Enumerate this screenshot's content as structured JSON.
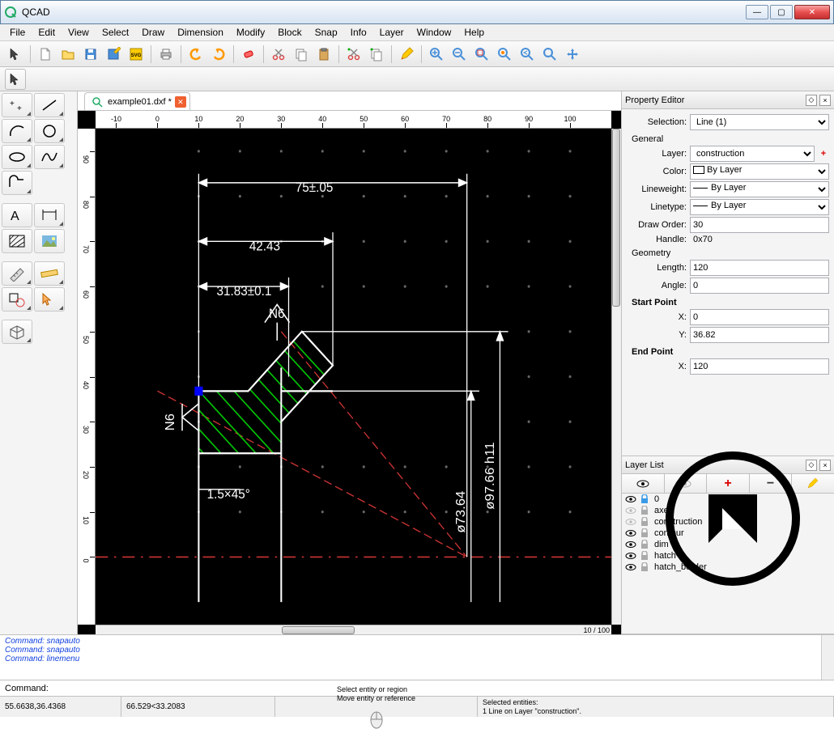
{
  "window": {
    "title": "QCAD"
  },
  "menu": [
    "File",
    "Edit",
    "View",
    "Select",
    "Draw",
    "Dimension",
    "Modify",
    "Block",
    "Snap",
    "Info",
    "Layer",
    "Window",
    "Help"
  ],
  "tab": {
    "name": "example01.dxf *"
  },
  "ruler_h": [
    -10,
    0,
    10,
    20,
    30,
    40,
    50,
    60,
    70,
    80,
    90,
    100
  ],
  "ruler_v": [
    0,
    10,
    20,
    30,
    40,
    50,
    60,
    70,
    80,
    90
  ],
  "dimensions": {
    "d1": "75±.05",
    "d2": "42.43",
    "d3": "31.83±0.1",
    "d4": "ø73.64",
    "d5": "ø97.66  h11",
    "chamfer": "1.5×45°",
    "n6a": "N6",
    "n6b": "N6"
  },
  "zoom": "10 / 100",
  "propEditor": {
    "title": "Property Editor",
    "selectionLabel": "Selection:",
    "selection": "Line (1)",
    "general": "General",
    "layerLabel": "Layer:",
    "layer": "construction",
    "colorLabel": "Color:",
    "color": "By Layer",
    "lwLabel": "Lineweight:",
    "lw": "By Layer",
    "ltLabel": "Linetype:",
    "lt": "By Layer",
    "drawOrderLabel": "Draw Order:",
    "drawOrder": "30",
    "handleLabel": "Handle:",
    "handle": "0x70",
    "geometry": "Geometry",
    "lengthLabel": "Length:",
    "length": "120",
    "angleLabel": "Angle:",
    "angle": "0",
    "startPoint": "Start Point",
    "spx": "X:",
    "spxv": "0",
    "spy": "Y:",
    "spyv": "36.82",
    "endPoint": "End Point",
    "epx": "X:",
    "epxv": "120"
  },
  "layerPanel": {
    "title": "Layer List",
    "layers": [
      {
        "name": "0",
        "visible": true,
        "locked": true,
        "locked_color": "#3a9be8"
      },
      {
        "name": "axes",
        "visible": false,
        "locked": true
      },
      {
        "name": "construction",
        "visible": false,
        "locked": true
      },
      {
        "name": "contour",
        "visible": true,
        "locked": false
      },
      {
        "name": "dim",
        "visible": true,
        "locked": false
      },
      {
        "name": "hatch",
        "visible": true,
        "locked": false
      },
      {
        "name": "hatch_border",
        "visible": true,
        "locked": false
      }
    ]
  },
  "history": [
    "Command: snapauto",
    "Command: snapauto",
    "Command: linemenu"
  ],
  "cmdLabel": "Command:",
  "status": {
    "abs": "55.6638,36.4368",
    "rel": "66.529<33.2083",
    "hint1": "Select entity or region",
    "hint2": "Move entity or reference",
    "sel1": "Selected entities:",
    "sel2": "1 Line on Layer \"construction\"."
  }
}
